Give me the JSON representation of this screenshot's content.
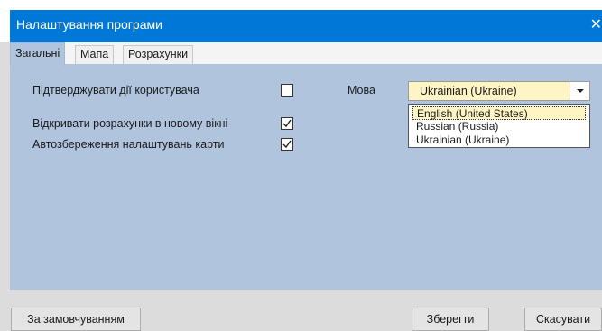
{
  "window": {
    "title": "Налаштування програми",
    "close_glyph": "✕"
  },
  "tabs": [
    {
      "label": "Загальні",
      "active": true
    },
    {
      "label": "Мапа",
      "active": false
    },
    {
      "label": "Розрахунки",
      "active": false
    }
  ],
  "general": {
    "confirm_actions": {
      "label": "Підтверджувати дії користувача",
      "checked": false
    },
    "open_calc_new_window": {
      "label": "Відкривати розрахунки в новому вікні",
      "checked": true
    },
    "autosave_map": {
      "label": "Автозбереження налаштувань карти",
      "checked": true
    },
    "language": {
      "label": "Мова",
      "selected": "Ukrainian (Ukraine)",
      "options": [
        "English (United States)",
        "Russian (Russia)",
        "Ukrainian (Ukraine)"
      ],
      "highlighted_option": "English (United States)"
    }
  },
  "buttons": {
    "defaults": "За замовчуванням",
    "save": "Зберегти",
    "cancel": "Скасувати"
  },
  "colors": {
    "titlebar": "#0078d7",
    "panel": "#b0c4de",
    "combo_value_bg": "#fff4c4"
  }
}
